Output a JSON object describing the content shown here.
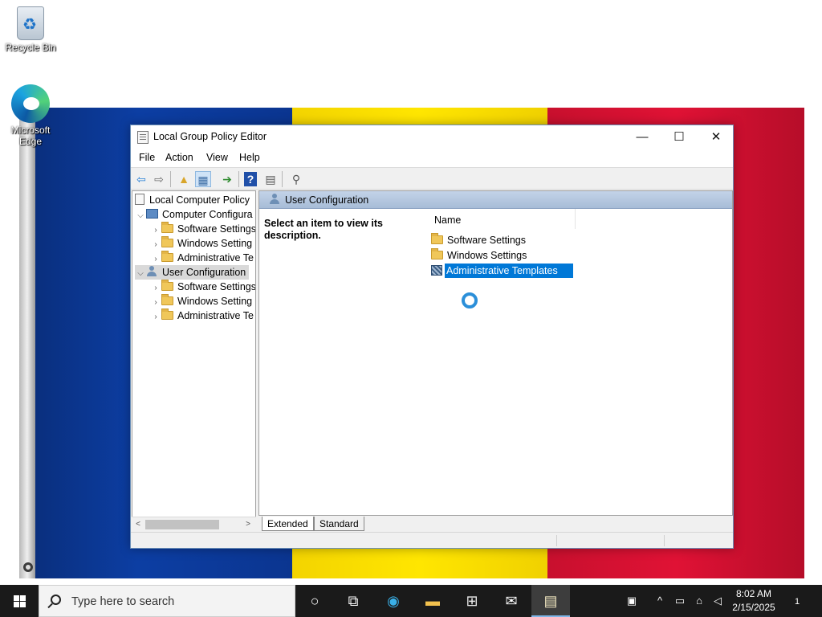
{
  "desktop": {
    "icons": [
      {
        "label": "Recycle Bin",
        "icon": "recycle-bin-icon"
      },
      {
        "label": "Microsoft Edge",
        "icon": "edge-icon"
      }
    ]
  },
  "window": {
    "title": "Local Group Policy Editor",
    "controls": {
      "minimize": "—",
      "maximize": "☐",
      "close": "✕"
    },
    "menu": [
      "File",
      "Action",
      "View",
      "Help"
    ],
    "toolbar": [
      {
        "icon": "back-arrow-icon",
        "glyph": "⇦",
        "color": "#1e7bd6"
      },
      {
        "icon": "forward-arrow-icon",
        "glyph": "⇨",
        "color": "#6b6b6b"
      },
      {
        "icon": "up-folder-icon",
        "glyph": "▲",
        "color": "#d8a52a"
      },
      {
        "icon": "show-hide-tree-icon",
        "glyph": "▦",
        "color": "#3e6ea5"
      },
      {
        "icon": "export-list-icon",
        "glyph": "➔",
        "color": "#2d8a2d"
      },
      {
        "icon": "help-icon",
        "glyph": "?",
        "color": "#1f4fa8"
      },
      {
        "icon": "properties-icon",
        "glyph": "▤",
        "color": "#555555"
      },
      {
        "icon": "filter-icon",
        "glyph": "⚲",
        "color": "#555555"
      }
    ]
  },
  "tree": {
    "root": "Local Computer Policy",
    "computer": "Computer Configura",
    "computer_children": [
      "Software Settings",
      "Windows Setting",
      "Administrative Te"
    ],
    "user": "User Configuration",
    "user_children": [
      "Software Settings",
      "Windows Setting",
      "Administrative Te"
    ]
  },
  "details": {
    "header": "User Configuration",
    "description": "Select an item to view its description.",
    "column": "Name",
    "items": [
      "Software Settings",
      "Windows Settings",
      "Administrative Templates"
    ],
    "selected": "Administrative Templates"
  },
  "tabs": [
    "Extended",
    "Standard"
  ],
  "taskbar": {
    "search_placeholder": "Type here to search",
    "time": "8:02 AM",
    "date": "2/15/2025",
    "notification_count": "1"
  },
  "colors": {
    "selection": "#0078d7",
    "taskbar": "#1a1a1a",
    "flag_blue": "#0c3ea3",
    "flag_yellow": "#ffe600",
    "flag_red": "#e01235"
  }
}
